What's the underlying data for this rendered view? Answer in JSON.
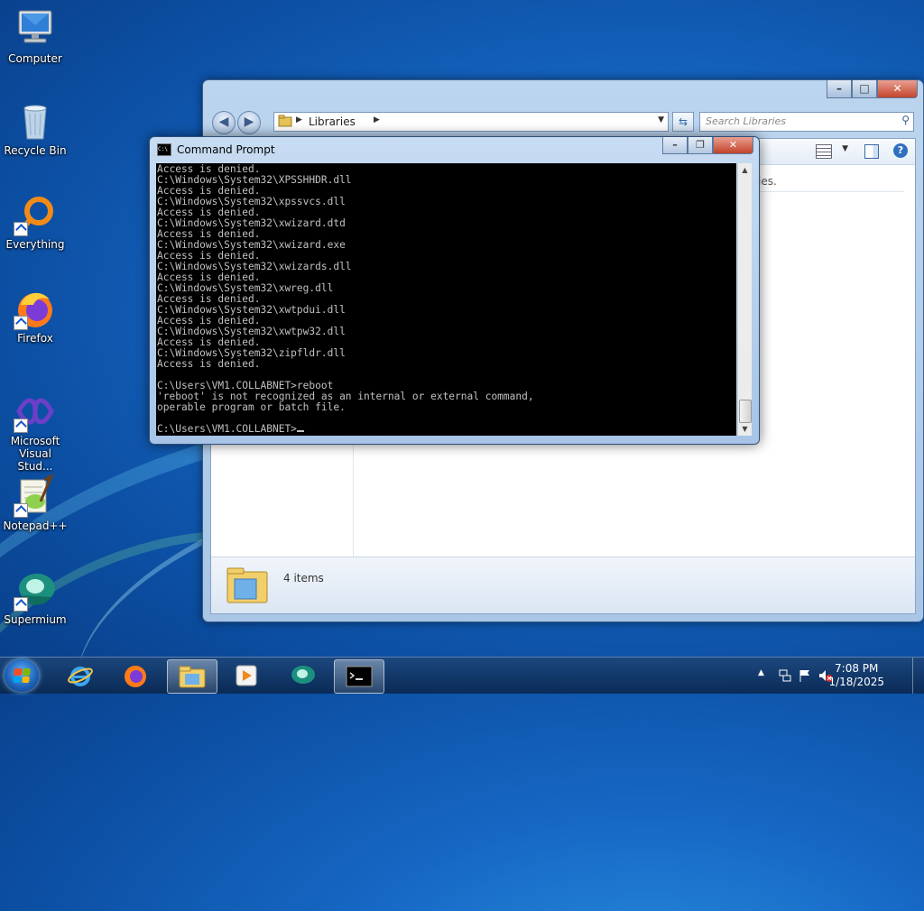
{
  "desktop": {
    "icons": [
      {
        "label": "Computer"
      },
      {
        "label": "Recycle Bin"
      },
      {
        "label": "Everything"
      },
      {
        "label": "Firefox"
      },
      {
        "label": "Microsoft Visual Stud..."
      },
      {
        "label": "Notepad++"
      },
      {
        "label": "Supermium"
      }
    ]
  },
  "explorer": {
    "address": "Libraries",
    "search_placeholder": "Search Libraries",
    "partial_text": "ies.",
    "status": "4 items"
  },
  "cmd": {
    "title": "Command Prompt",
    "lines": [
      "Access is denied.",
      "C:\\Windows\\System32\\XPSSHHDR.dll",
      "Access is denied.",
      "C:\\Windows\\System32\\xpssvcs.dll",
      "Access is denied.",
      "C:\\Windows\\System32\\xwizard.dtd",
      "Access is denied.",
      "C:\\Windows\\System32\\xwizard.exe",
      "Access is denied.",
      "C:\\Windows\\System32\\xwizards.dll",
      "Access is denied.",
      "C:\\Windows\\System32\\xwreg.dll",
      "Access is denied.",
      "C:\\Windows\\System32\\xwtpdui.dll",
      "Access is denied.",
      "C:\\Windows\\System32\\xwtpw32.dll",
      "Access is denied.",
      "C:\\Windows\\System32\\zipfldr.dll",
      "Access is denied.",
      "",
      "C:\\Users\\VM1.COLLABNET>reboot",
      "'reboot' is not recognized as an internal or external command,",
      "operable program or batch file.",
      "",
      "C:\\Users\\VM1.COLLABNET>"
    ]
  },
  "taskbar": {
    "time": "7:08 PM",
    "date": "1/18/2025",
    "colors": {
      "start_orb": "#1c5fb5",
      "flag_red": "#f25022",
      "flag_green": "#7fba00",
      "flag_blue": "#00a4ef",
      "flag_yellow": "#ffb900"
    }
  }
}
